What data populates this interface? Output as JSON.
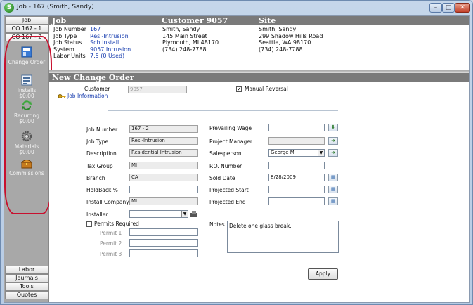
{
  "window": {
    "title": "Job - 167 (Smith, Sandy)",
    "app_badge": "S"
  },
  "sidebar": {
    "top_tabs": [
      {
        "label": "Job"
      },
      {
        "label": "CO 167 - 1"
      },
      {
        "label": "CO 167 - 2"
      }
    ],
    "items": [
      {
        "label": "Change Order",
        "sub": ""
      },
      {
        "label": "Installs",
        "sub": "$0.00"
      },
      {
        "label": "Recurring",
        "sub": "$0.00"
      },
      {
        "label": "Materials",
        "sub": "$0.00"
      },
      {
        "label": "Commissions",
        "sub": ""
      }
    ],
    "bottom_tabs": [
      {
        "label": "Labor"
      },
      {
        "label": "Journals"
      },
      {
        "label": "Tools"
      },
      {
        "label": "Quotes"
      }
    ]
  },
  "header": {
    "job_heading": "Job",
    "customer_heading": "Customer 9057",
    "site_heading": "Site",
    "job_info": {
      "job_number_label": "Job Number",
      "job_number": "167",
      "job_type_label": "Job Type",
      "job_type": "Resi-Intrusion",
      "job_status_label": "Job Status",
      "job_status": "Sch Install",
      "system_label": "System",
      "system": "9057 Intrusion",
      "labor_units_label": "Labor Units",
      "labor_units": "7.5 (0 Used)"
    },
    "customer": {
      "name": "Smith, Sandy",
      "street": "145 Main Street",
      "city": "Plymouth, MI  48170",
      "phone": "(734) 248-7788"
    },
    "site": {
      "name": "Smith, Sandy",
      "street": "299 Shadow Hills Road",
      "city": "Seattle, WA  98170",
      "phone": "(734) 248-7788"
    }
  },
  "form": {
    "section_title": "New Change Order",
    "customer_label": "Customer",
    "customer_value": "9057",
    "job_information_link": "Job Information",
    "manual_reversal_label": "Manual Reversal",
    "manual_reversal_checked": "✔",
    "left": {
      "job_number_label": "Job Number",
      "job_number": "167 - 2",
      "job_type_label": "Job Type",
      "job_type": "Resi-Intrusion",
      "description_label": "Description",
      "description": "Residential Intrusion",
      "tax_group_label": "Tax Group",
      "tax_group": "MI",
      "branch_label": "Branch",
      "branch": "CA",
      "holdback_label": "HoldBack  %",
      "holdback": "",
      "install_company_label": "Install Company",
      "install_company": "MI",
      "installer_label": "Installer",
      "installer": ""
    },
    "right": {
      "prevailing_wage_label": "Prevailing Wage",
      "prevailing_wage": "",
      "project_manager_label": "Project Manager",
      "project_manager": "",
      "salesperson_label": "Salesperson",
      "salesperson": "George M",
      "po_number_label": "P.O. Number",
      "po_number": "",
      "sold_date_label": "Sold Date",
      "sold_date": "8/28/2009",
      "projected_start_label": "Projected Start",
      "projected_start": "",
      "projected_end_label": "Projected End",
      "projected_end": ""
    },
    "permits": {
      "required_label": "Permits Required",
      "permit1_label": "Permit 1",
      "permit2_label": "Permit 2",
      "permit3_label": "Permit 3"
    },
    "notes_label": "Notes",
    "notes_value": "Delete one glass break.",
    "apply_label": "Apply"
  },
  "colors": {
    "annotation_oval": "#c8102e",
    "header_bg": "#7a7a7a",
    "link_blue": "#1a3fb0"
  }
}
